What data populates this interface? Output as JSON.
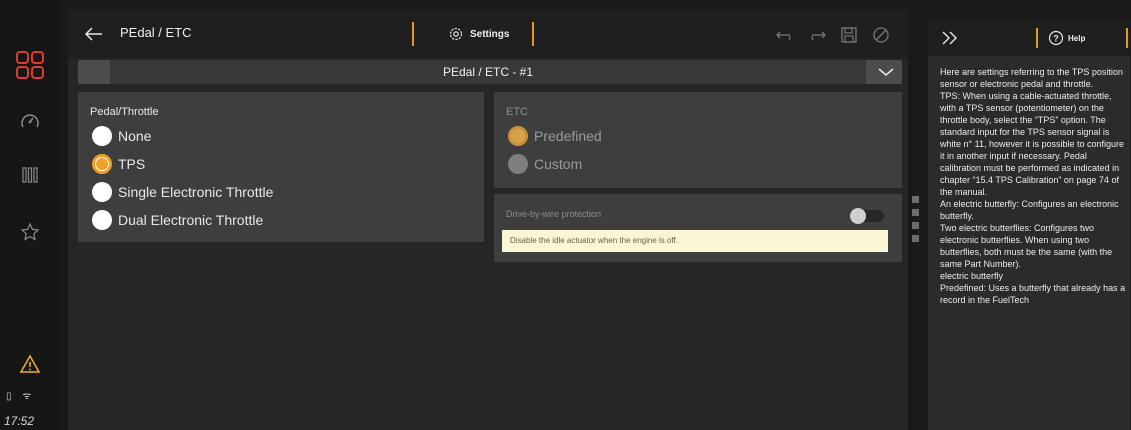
{
  "rail": {
    "time": "17:52",
    "status": "▯ ᯤ",
    "colors": {
      "accent": "#e03c2a",
      "warning": "#f0b030"
    }
  },
  "header": {
    "title": "PEdal / ETC",
    "settings_tab": "Settings"
  },
  "selector": {
    "value": "PEdal / ETC - #1"
  },
  "pedal": {
    "title": "Pedal/Throttle",
    "options": [
      {
        "label": "None",
        "selected": false
      },
      {
        "label": "TPS",
        "selected": true
      },
      {
        "label": "Single Electronic Throttle",
        "selected": false
      },
      {
        "label": "Dual Electronic Throttle",
        "selected": false
      }
    ]
  },
  "etc": {
    "title": "ETC",
    "options": [
      {
        "label": "Predefined",
        "selected": true
      },
      {
        "label": "Custom",
        "selected": false
      }
    ]
  },
  "dbw": {
    "title": "Drive-by-wire protection",
    "enabled": false,
    "hint": "Disable the idle actuator when the engine is off."
  },
  "help": {
    "tab": "Help",
    "paragraphs": [
      "Here are settings referring to the TPS position sensor or electronic pedal and throttle.",
      "TPS: When using a cable-actuated throttle, with a TPS sensor (potentiometer) on the throttle body, select the “TPS” option. The standard input for the TPS sensor signal is white n° 11, however it is possible to configure it in another input if necessary. Pedal calibration must be performed as indicated in chapter “15.4 TPS Calibration” on page 74 of the manual.",
      "An electric butterfly: Configures an electronic butterfly.",
      "Two electric butterflies: Configures two electronic butterflies. When using two butterflies, both must be the same (with the same Part Number).",
      "electric butterfly",
      "Predefined: Uses a butterfly that already has a record in the FuelTech"
    ]
  }
}
